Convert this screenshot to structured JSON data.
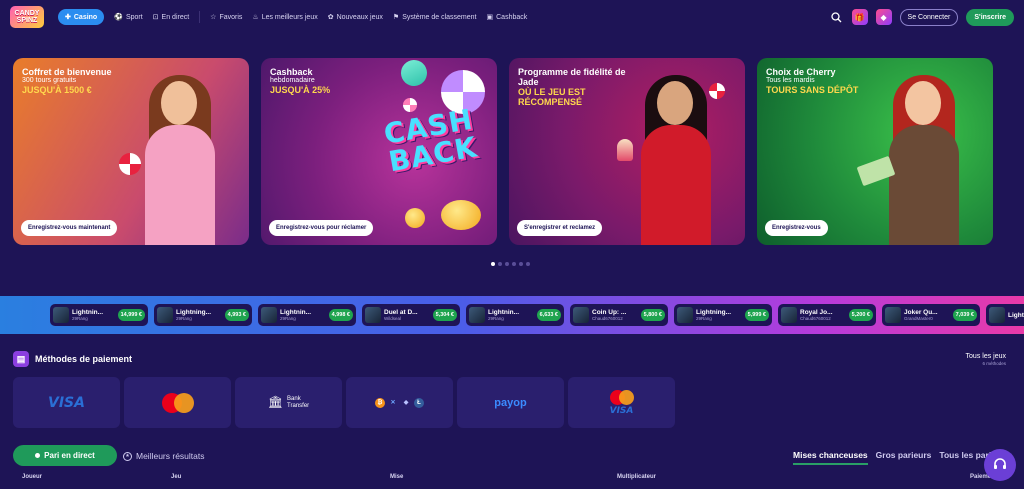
{
  "brand": {
    "logo_text": "CANDY SPINZ"
  },
  "nav": [
    {
      "label": "Casino",
      "icon": "casino-icon",
      "active": true
    },
    {
      "label": "Sport",
      "icon": "sport-icon"
    },
    {
      "label": "En direct",
      "icon": "live-icon"
    },
    {
      "label": "Favoris",
      "icon": "star-icon"
    },
    {
      "label": "Les meilleurs jeux",
      "icon": "fire-icon"
    },
    {
      "label": "Nouveaux jeux",
      "icon": "new-icon"
    },
    {
      "label": "Système de classement",
      "icon": "ranking-icon"
    },
    {
      "label": "Cashback",
      "icon": "cashback-icon"
    }
  ],
  "header": {
    "login_label": "Se Connecter",
    "signup_label": "S'inscrire"
  },
  "promos": [
    {
      "title": "Coffret de bienvenue",
      "subtitle": "300 tours gratuits",
      "highlight": "JUSQU'À 1500 €",
      "button": "Enregistrez-vous maintenant"
    },
    {
      "title": "Cashback",
      "subtitle": "hebdomadaire",
      "highlight": "JUSQU'À 25%",
      "button": "Enregistrez-vous pour réclamer",
      "art_word_1": "CASH",
      "art_word_2": "BACK"
    },
    {
      "title": "Programme de fidélité de Jade",
      "subtitle": "",
      "highlight": "OÙ LE JEU EST RÉCOMPENSÉ",
      "button": "S'enregistrer et reclamez"
    },
    {
      "title": "Choix de Cherry",
      "subtitle": "Tous les mardis",
      "highlight": "TOURS SANS DÉPÔT",
      "button": "Enregistrez-vous"
    }
  ],
  "carousel": {
    "dots": 6,
    "active_index": 0
  },
  "ticker": [
    {
      "name": "Lightnin...",
      "user": "29Rang",
      "amount": "14,999 €"
    },
    {
      "name": "Lightning...",
      "user": "29Rang",
      "amount": "4,993 €"
    },
    {
      "name": "Lightnin...",
      "user": "29Rang",
      "amount": "4,998 €"
    },
    {
      "name": "Duel at D...",
      "user": "Wildseal",
      "amount": "5,304 €"
    },
    {
      "name": "Lightnin...",
      "user": "29Rang",
      "amount": "6,633 €"
    },
    {
      "name": "Coin Up: ...",
      "user": "Chaud6760012",
      "amount": "5,800 €"
    },
    {
      "name": "Lightning...",
      "user": "29Rang",
      "amount": "5,999 €"
    },
    {
      "name": "Royal Jo...",
      "user": "Chaud6760012",
      "amount": "5,200 €"
    },
    {
      "name": "Joker Qu...",
      "user": "GrandMaster0",
      "amount": "7,039 €"
    },
    {
      "name": "Lightn",
      "user": "",
      "amount": ""
    }
  ],
  "payments": {
    "title": "Méthodes de paiement",
    "all_games_label": "Tous les jeux",
    "all_games_count": "6 méthodes",
    "methods": [
      {
        "name": "VISA"
      },
      {
        "name": "Mastercard"
      },
      {
        "name": "Bank Transfer",
        "line1": "Bank",
        "line2": "Transfer"
      },
      {
        "name": "Crypto"
      },
      {
        "name": "payop"
      },
      {
        "name": "Mastercard VISA",
        "label": "VISA"
      }
    ]
  },
  "bets": {
    "live_button": "Pari en direct",
    "best_results": "Meilleurs résultats",
    "tabs": [
      "Mises chanceuses",
      "Gros parieurs",
      "Tous les paris"
    ],
    "columns": [
      "Joueur",
      "Jeu",
      "Mise",
      "Multiplicateur",
      "Paiement"
    ]
  },
  "colors": {
    "background": "#1e1456",
    "accent_green": "#1f9a5a",
    "accent_blue": "#2b8df0",
    "highlight_yellow": "#ffd84d"
  }
}
